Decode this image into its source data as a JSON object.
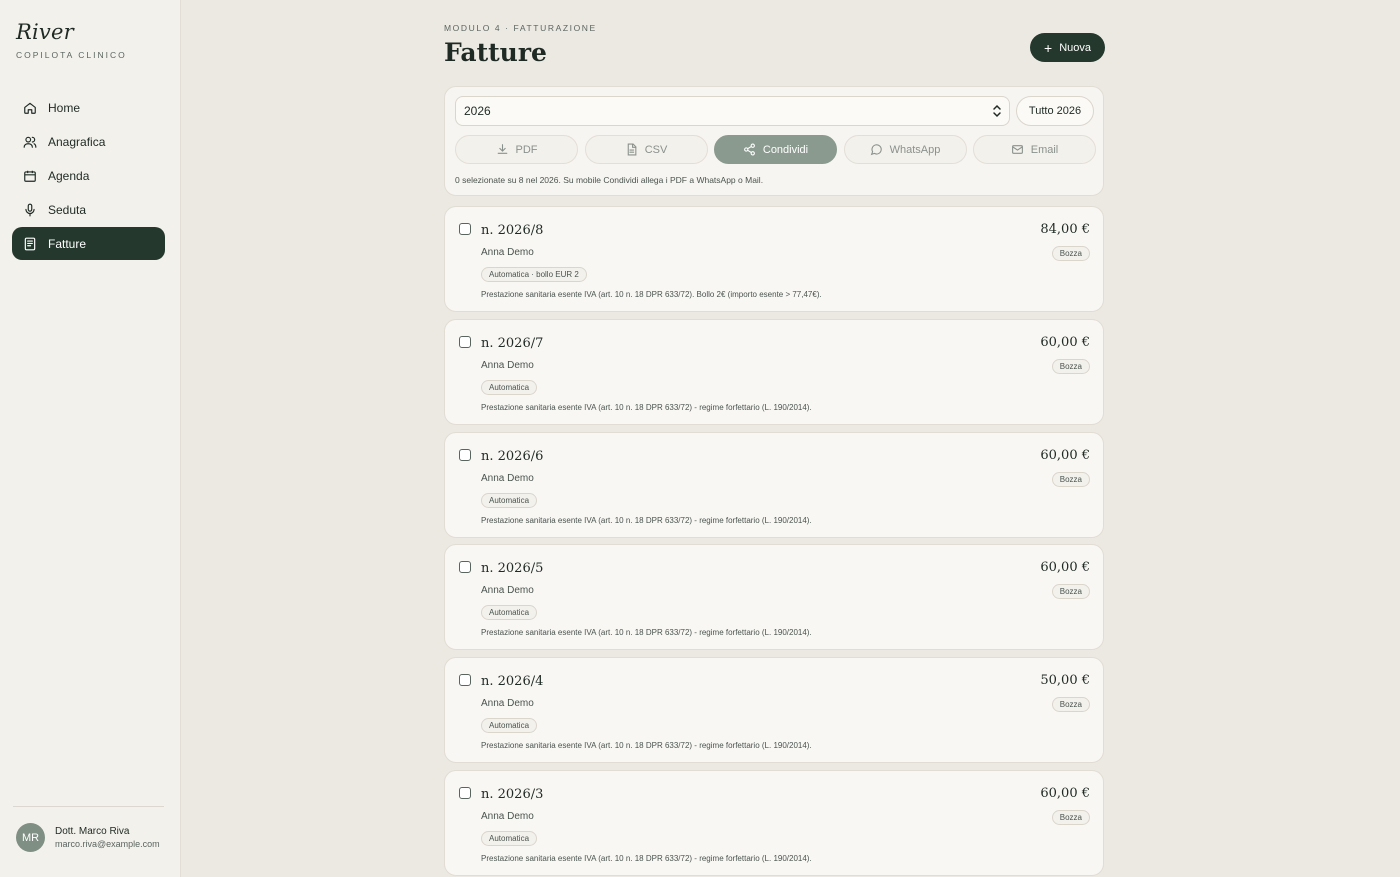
{
  "brand": {
    "name": "River",
    "subtitle": "COPILOTA CLINICO"
  },
  "sidebar": {
    "items": [
      {
        "label": "Home",
        "icon": "home-icon"
      },
      {
        "label": "Anagrafica",
        "icon": "users-icon"
      },
      {
        "label": "Agenda",
        "icon": "calendar-icon"
      },
      {
        "label": "Seduta",
        "icon": "microphone-icon"
      },
      {
        "label": "Fatture",
        "icon": "invoice-icon",
        "active": true
      }
    ]
  },
  "user": {
    "initials": "MR",
    "name": "Dott. Marco Riva",
    "email": "marco.riva@example.com"
  },
  "header": {
    "eyebrow": "MODULO 4 · FATTURAZIONE",
    "title": "Fatture",
    "new_label": "Nuova"
  },
  "filters": {
    "year_value": "2026",
    "range_label": "Tutto 2026",
    "actions": [
      {
        "label": "PDF",
        "icon": "download-icon"
      },
      {
        "label": "CSV",
        "icon": "document-icon"
      },
      {
        "label": "Condividi",
        "icon": "share-icon",
        "primary": true
      },
      {
        "label": "WhatsApp",
        "icon": "chat-icon"
      },
      {
        "label": "Email",
        "icon": "mail-icon"
      }
    ],
    "note": "0 selezionate su 8 nel 2026. Su mobile Condividi allega i PDF a WhatsApp o Mail."
  },
  "invoices": [
    {
      "number": "n. 2026/8",
      "client": "Anna Demo",
      "tag": "Automatica · bollo EUR 2",
      "note": "Prestazione sanitaria esente IVA (art. 10 n. 18 DPR 633/72). Bollo 2€ (importo esente > 77,47€).",
      "amount": "84,00 €",
      "status": "Bozza"
    },
    {
      "number": "n. 2026/7",
      "client": "Anna Demo",
      "tag": "Automatica",
      "note": "Prestazione sanitaria esente IVA (art. 10 n. 18 DPR 633/72) - regime forfettario (L. 190/2014).",
      "amount": "60,00 €",
      "status": "Bozza"
    },
    {
      "number": "n. 2026/6",
      "client": "Anna Demo",
      "tag": "Automatica",
      "note": "Prestazione sanitaria esente IVA (art. 10 n. 18 DPR 633/72) - regime forfettario (L. 190/2014).",
      "amount": "60,00 €",
      "status": "Bozza"
    },
    {
      "number": "n. 2026/5",
      "client": "Anna Demo",
      "tag": "Automatica",
      "note": "Prestazione sanitaria esente IVA (art. 10 n. 18 DPR 633/72) - regime forfettario (L. 190/2014).",
      "amount": "60,00 €",
      "status": "Bozza"
    },
    {
      "number": "n. 2026/4",
      "client": "Anna Demo",
      "tag": "Automatica",
      "note": "Prestazione sanitaria esente IVA (art. 10 n. 18 DPR 633/72) - regime forfettario (L. 190/2014).",
      "amount": "50,00 €",
      "status": "Bozza"
    },
    {
      "number": "n. 2026/3",
      "client": "Anna Demo",
      "tag": "Automatica",
      "note": "Prestazione sanitaria esente IVA (art. 10 n. 18 DPR 633/72) - regime forfettario (L. 190/2014).",
      "amount": "60,00 €",
      "status": "Bozza"
    }
  ],
  "colors": {
    "accent": "#24382d",
    "share_button": "#8a9a8f",
    "background": "#ece9e2"
  }
}
